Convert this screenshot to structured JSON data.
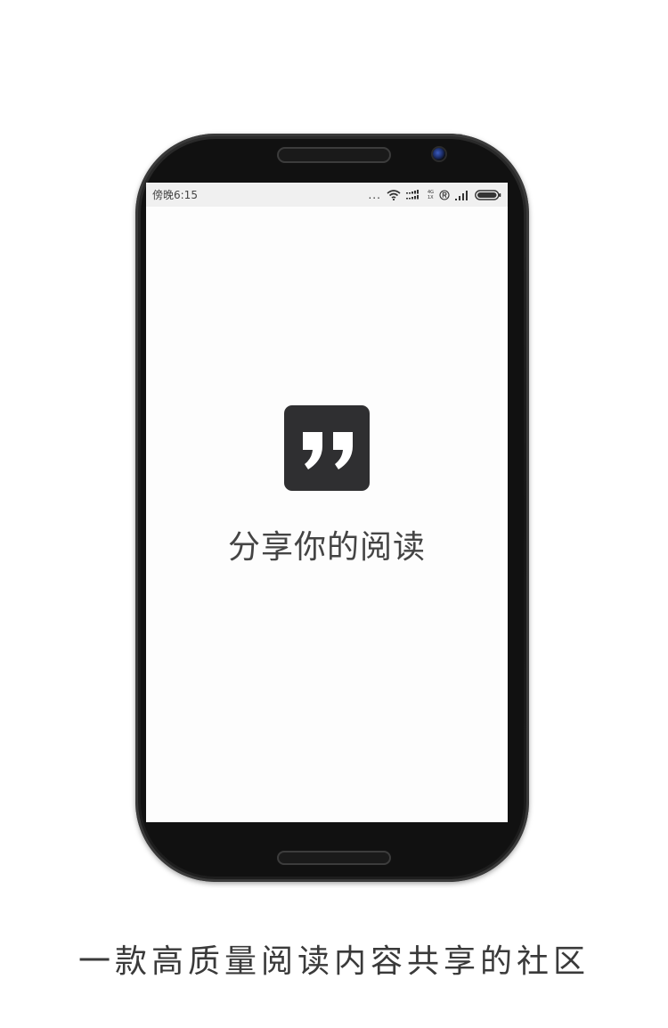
{
  "statusbar": {
    "time": "傍晚6:15",
    "dots": "...",
    "network_top": "4G",
    "network_bottom": "1X",
    "icons": [
      "wifi-icon",
      "signal-bars-icon",
      "registered-icon",
      "cell-signal-icon",
      "battery-icon"
    ]
  },
  "app": {
    "logo_icon": "quote-mark-icon",
    "title": "分享你的阅读"
  },
  "caption": "一款高质量阅读内容共享的社区",
  "colors": {
    "logo_bg": "#2f2f31",
    "screen_bg": "#fdfdfd",
    "statusbar_bg": "#f0f0f0",
    "phone_body": "#161616"
  }
}
